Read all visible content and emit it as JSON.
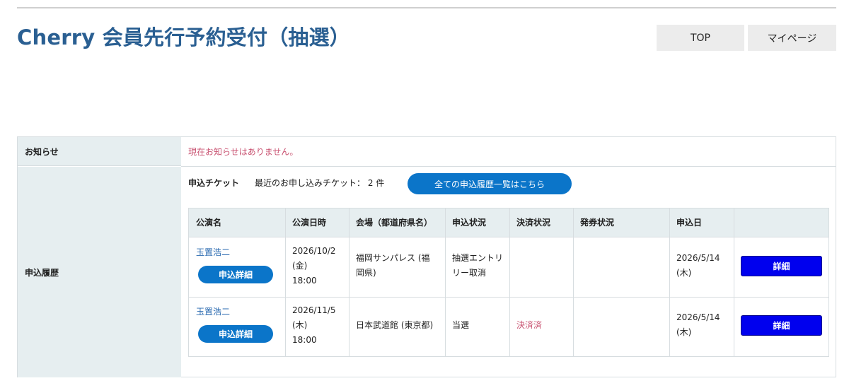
{
  "header": {
    "title": "Cherry 会員先行予約受付（抽選）",
    "nav": {
      "top_label": "TOP",
      "mypage_label": "マイページ"
    }
  },
  "notice": {
    "label": "お知らせ",
    "text": "現在お知らせはありません。"
  },
  "history": {
    "label": "申込履歴",
    "ticket_heading": "申込チケット",
    "recent_count_text": "最近のお申し込みチケット： 2 件",
    "all_history_button": "全ての申込履歴一覧はこちら",
    "columns": [
      "公演名",
      "公演日時",
      "会場（都道府県名）",
      "申込状況",
      "決済状況",
      "発券状況",
      "申込日",
      ""
    ],
    "rows": [
      {
        "performer": "玉置浩二",
        "detail_pill": "申込詳細",
        "date_line1": "2026/10/2",
        "date_line2": "(金)",
        "date_line3": "18:00",
        "venue_line1": "福岡サンパレス (福",
        "venue_line2": "岡県)",
        "status_line1": "抽選エントリ",
        "status_line2": "リー取消",
        "payment": "",
        "ticketing": "",
        "applied_line1": "2026/5/14",
        "applied_line2": "(木)",
        "detail_button": "詳細"
      },
      {
        "performer": "玉置浩二",
        "detail_pill": "申込詳細",
        "date_line1": "2026/11/5",
        "date_line2": "(木)",
        "date_line3": "18:00",
        "venue_line1": "日本武道館 (東京都)",
        "venue_line2": "",
        "status_line1": "当選",
        "status_line2": "",
        "payment": "決済済",
        "ticketing": "",
        "applied_line1": "2026/5/14",
        "applied_line2": "(木)",
        "detail_button": "詳細"
      }
    ]
  },
  "colors": {
    "title": "#2a5f92",
    "accent_blue": "#0b75c9",
    "detail_button": "#0000ee",
    "notice_pink": "#c8506f",
    "label_bg": "#e6eef0"
  }
}
